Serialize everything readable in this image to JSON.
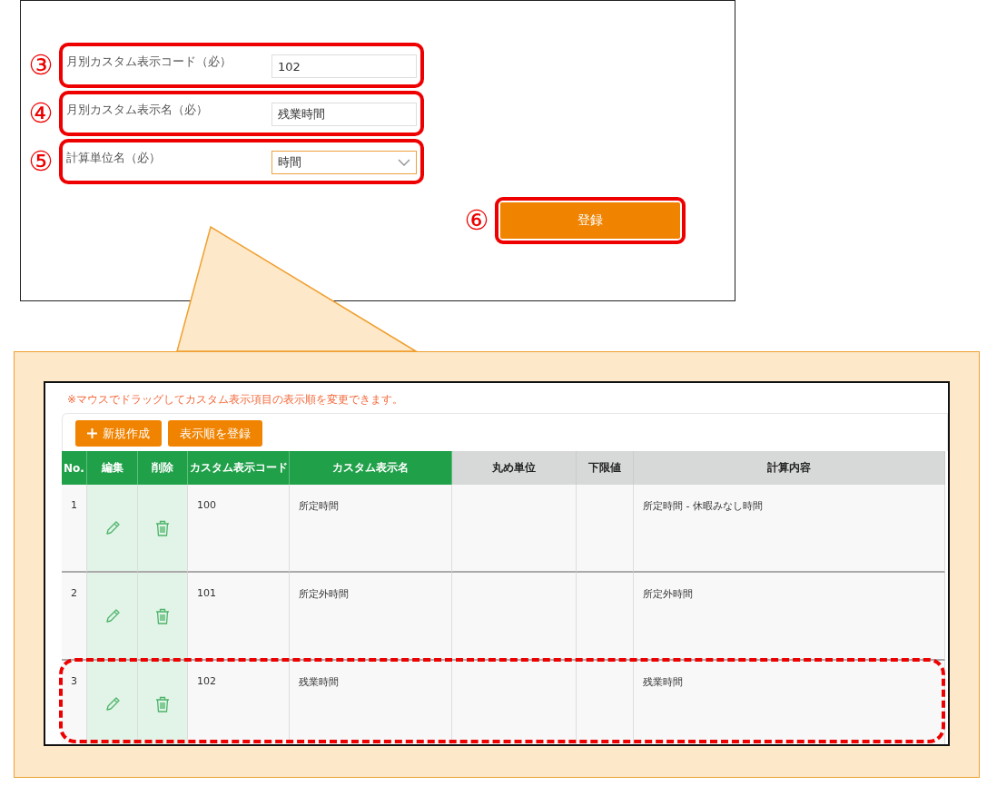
{
  "form": {
    "fields": [
      {
        "number": "③",
        "label": "月別カスタム表示コード（必）",
        "kind": "text",
        "value": "102",
        "highlighted": true
      },
      {
        "number": "④",
        "label": "月別カスタム表示名（必）",
        "kind": "text",
        "value": "残業時間",
        "highlighted": true
      },
      {
        "number": "⑤",
        "label": "計算単位名（必）",
        "kind": "select",
        "value": "時間",
        "highlighted": true
      }
    ],
    "submit": {
      "number": "⑥",
      "label": "登録",
      "highlighted": true
    }
  },
  "list": {
    "notice": "※マウスでドラッグしてカスタム表示項目の表示順を変更できます。",
    "buttons": [
      {
        "label": "新規作成",
        "kind": "add"
      },
      {
        "label": "表示順を登録",
        "kind": "plain"
      }
    ],
    "table": {
      "columns": [
        {
          "label": "No.",
          "highlighted": true
        },
        {
          "label": "編集",
          "highlighted": true
        },
        {
          "label": "削除",
          "highlighted": true
        },
        {
          "label": "カスタム表示コード",
          "highlighted": true
        },
        {
          "label": "カスタム表示名",
          "highlighted": true
        },
        {
          "label": "丸め単位",
          "highlighted": false
        },
        {
          "label": "下限値",
          "highlighted": false
        },
        {
          "label": "計算内容",
          "highlighted": false
        }
      ],
      "rows": [
        {
          "no": "1",
          "code": "100",
          "name": "所定時間",
          "calculation": "所定時間 - 休暇みなし時間",
          "highlighted": false
        },
        {
          "no": "2",
          "code": "101",
          "name": "所定外時間",
          "calculation": "所定外時間",
          "highlighted": false
        },
        {
          "no": "3",
          "code": "102",
          "name": "残業時間",
          "calculation": "残業時間",
          "highlighted": true
        }
      ]
    }
  }
}
